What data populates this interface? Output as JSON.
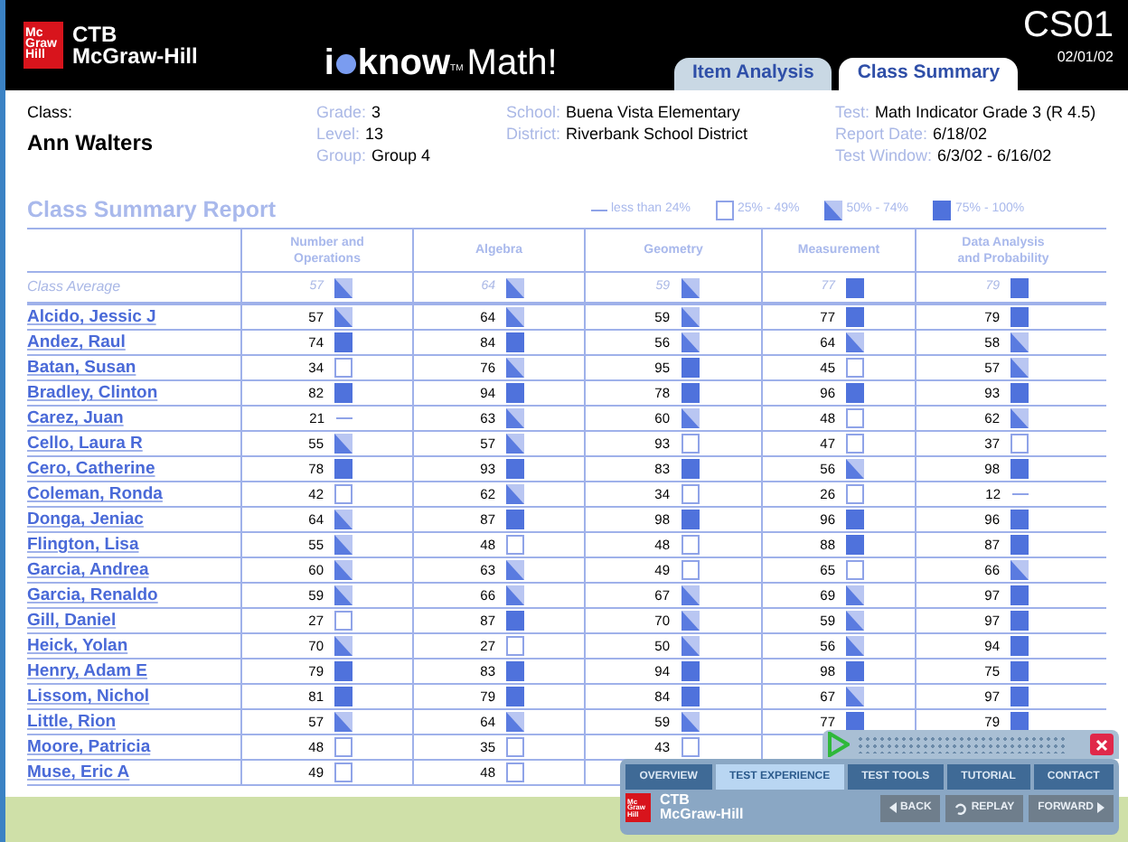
{
  "header": {
    "logo": {
      "mark": [
        "Mc",
        "Graw",
        "Hill"
      ],
      "name": [
        "CTB",
        "McGraw-Hill"
      ]
    },
    "product": {
      "pre": "i",
      "word": "know",
      "tm": "TM",
      "suffix": "Math!"
    },
    "code": "CS01",
    "date": "02/01/02"
  },
  "tabs": [
    {
      "label": "Item Analysis",
      "selected": false
    },
    {
      "label": "Class Summary",
      "selected": true
    }
  ],
  "info": {
    "class_label": "Class:",
    "class_name": "Ann Walters",
    "col1": [
      {
        "label": "Grade:",
        "value": "3"
      },
      {
        "label": "Level:",
        "value": "13"
      },
      {
        "label": "Group:",
        "value": "Group 4"
      }
    ],
    "col2": [
      {
        "label": "School:",
        "value": "Buena Vista Elementary"
      },
      {
        "label": "District:",
        "value": "Riverbank School District"
      }
    ],
    "col3": [
      {
        "label": "Test:",
        "value": "Math Indicator Grade 3 (R 4.5)"
      },
      {
        "label": "Report Date:",
        "value": "6/18/02"
      },
      {
        "label": "Test Window:",
        "value": "6/3/02 - 6/16/02"
      }
    ]
  },
  "report_title": "Class Summary Report",
  "legend": [
    {
      "kind": "low",
      "label": "less than 24%"
    },
    {
      "kind": "basic",
      "label": "25% - 49%"
    },
    {
      "kind": "mid",
      "label": "50% - 74%"
    },
    {
      "kind": "high",
      "label": "75% - 100%"
    }
  ],
  "table": {
    "columns": [
      [
        "Number and",
        "Operations"
      ],
      [
        "Algebra"
      ],
      [
        "Geometry"
      ],
      [
        "Measurement"
      ],
      [
        "Data Analysis",
        "and Probability"
      ]
    ],
    "average": {
      "label": "Class Average",
      "scores": [
        {
          "value": "57",
          "kind": "mid"
        },
        {
          "value": "64",
          "kind": "mid"
        },
        {
          "value": "59",
          "kind": "mid"
        },
        {
          "value": "77",
          "kind": "high"
        },
        {
          "value": "79",
          "kind": "high"
        }
      ]
    },
    "rows": [
      {
        "name": "Alcido, Jessic J",
        "scores": [
          {
            "value": "57",
            "kind": "mid"
          },
          {
            "value": "64",
            "kind": "mid"
          },
          {
            "value": "59",
            "kind": "mid"
          },
          {
            "value": "77",
            "kind": "high"
          },
          {
            "value": "79",
            "kind": "high"
          }
        ]
      },
      {
        "name": "Andez, Raul",
        "scores": [
          {
            "value": "74",
            "kind": "high"
          },
          {
            "value": "84",
            "kind": "high"
          },
          {
            "value": "56",
            "kind": "mid"
          },
          {
            "value": "64",
            "kind": "mid"
          },
          {
            "value": "58",
            "kind": "mid"
          }
        ]
      },
      {
        "name": "Batan, Susan",
        "scores": [
          {
            "value": "34",
            "kind": "basic"
          },
          {
            "value": "76",
            "kind": "mid"
          },
          {
            "value": "95",
            "kind": "high"
          },
          {
            "value": "45",
            "kind": "basic"
          },
          {
            "value": "57",
            "kind": "mid"
          }
        ]
      },
      {
        "name": "Bradley, Clinton",
        "scores": [
          {
            "value": "82",
            "kind": "high"
          },
          {
            "value": "94",
            "kind": "high"
          },
          {
            "value": "78",
            "kind": "high"
          },
          {
            "value": "96",
            "kind": "high"
          },
          {
            "value": "93",
            "kind": "high"
          }
        ]
      },
      {
        "name": "Carez, Juan",
        "scores": [
          {
            "value": "21",
            "kind": "low"
          },
          {
            "value": "63",
            "kind": "mid"
          },
          {
            "value": "60",
            "kind": "mid"
          },
          {
            "value": "48",
            "kind": "basic"
          },
          {
            "value": "62",
            "kind": "mid"
          }
        ]
      },
      {
        "name": "Cello, Laura R",
        "scores": [
          {
            "value": "55",
            "kind": "mid"
          },
          {
            "value": "57",
            "kind": "mid"
          },
          {
            "value": "93",
            "kind": "basic"
          },
          {
            "value": "47",
            "kind": "basic"
          },
          {
            "value": "37",
            "kind": "basic"
          }
        ]
      },
      {
        "name": "Cero, Catherine",
        "scores": [
          {
            "value": "78",
            "kind": "high"
          },
          {
            "value": "93",
            "kind": "high"
          },
          {
            "value": "83",
            "kind": "high"
          },
          {
            "value": "56",
            "kind": "mid"
          },
          {
            "value": "98",
            "kind": "high"
          }
        ]
      },
      {
        "name": "Coleman, Ronda",
        "scores": [
          {
            "value": "42",
            "kind": "basic"
          },
          {
            "value": "62",
            "kind": "mid"
          },
          {
            "value": "34",
            "kind": "basic"
          },
          {
            "value": "26",
            "kind": "basic"
          },
          {
            "value": "12",
            "kind": "low"
          }
        ]
      },
      {
        "name": "Donga, Jeniac",
        "scores": [
          {
            "value": "64",
            "kind": "mid"
          },
          {
            "value": "87",
            "kind": "high"
          },
          {
            "value": "98",
            "kind": "high"
          },
          {
            "value": "96",
            "kind": "high"
          },
          {
            "value": "96",
            "kind": "high"
          }
        ]
      },
      {
        "name": "Flington, Lisa",
        "scores": [
          {
            "value": "55",
            "kind": "mid"
          },
          {
            "value": "48",
            "kind": "basic"
          },
          {
            "value": "48",
            "kind": "basic"
          },
          {
            "value": "88",
            "kind": "high"
          },
          {
            "value": "87",
            "kind": "high"
          }
        ]
      },
      {
        "name": "Garcia, Andrea",
        "scores": [
          {
            "value": "60",
            "kind": "mid"
          },
          {
            "value": "63",
            "kind": "mid"
          },
          {
            "value": "49",
            "kind": "basic"
          },
          {
            "value": "65",
            "kind": "basic"
          },
          {
            "value": "66",
            "kind": "mid"
          }
        ]
      },
      {
        "name": "Garcia, Renaldo",
        "scores": [
          {
            "value": "59",
            "kind": "mid"
          },
          {
            "value": "66",
            "kind": "mid"
          },
          {
            "value": "67",
            "kind": "mid"
          },
          {
            "value": "69",
            "kind": "mid"
          },
          {
            "value": "97",
            "kind": "high"
          }
        ]
      },
      {
        "name": "Gill, Daniel",
        "scores": [
          {
            "value": "27",
            "kind": "basic"
          },
          {
            "value": "87",
            "kind": "high"
          },
          {
            "value": "70",
            "kind": "mid"
          },
          {
            "value": "59",
            "kind": "mid"
          },
          {
            "value": "97",
            "kind": "high"
          }
        ]
      },
      {
        "name": "Heick, Yolan",
        "scores": [
          {
            "value": "70",
            "kind": "mid"
          },
          {
            "value": "27",
            "kind": "basic"
          },
          {
            "value": "50",
            "kind": "mid"
          },
          {
            "value": "56",
            "kind": "mid"
          },
          {
            "value": "94",
            "kind": "high"
          }
        ]
      },
      {
        "name": "Henry, Adam E",
        "scores": [
          {
            "value": "79",
            "kind": "high"
          },
          {
            "value": "83",
            "kind": "high"
          },
          {
            "value": "94",
            "kind": "high"
          },
          {
            "value": "98",
            "kind": "high"
          },
          {
            "value": "75",
            "kind": "high"
          }
        ]
      },
      {
        "name": "Lissom, Nichol",
        "scores": [
          {
            "value": "81",
            "kind": "high"
          },
          {
            "value": "79",
            "kind": "high"
          },
          {
            "value": "84",
            "kind": "high"
          },
          {
            "value": "67",
            "kind": "mid"
          },
          {
            "value": "97",
            "kind": "high"
          }
        ]
      },
      {
        "name": "Little, Rion",
        "scores": [
          {
            "value": "57",
            "kind": "mid"
          },
          {
            "value": "64",
            "kind": "mid"
          },
          {
            "value": "59",
            "kind": "mid"
          },
          {
            "value": "77",
            "kind": "high"
          },
          {
            "value": "79",
            "kind": "high"
          }
        ]
      },
      {
        "name": "Moore, Patricia",
        "scores": [
          {
            "value": "48",
            "kind": "basic"
          },
          {
            "value": "35",
            "kind": "basic"
          },
          {
            "value": "43",
            "kind": "basic"
          }
        ]
      },
      {
        "name": "Muse, Eric A",
        "scores": [
          {
            "value": "49",
            "kind": "basic"
          },
          {
            "value": "48",
            "kind": "basic"
          }
        ]
      }
    ]
  },
  "player": {
    "tabs": [
      {
        "label": "OVERVIEW",
        "selected": false
      },
      {
        "label": "TEST EXPERIENCE",
        "selected": true
      },
      {
        "label": "TEST TOOLS",
        "selected": false
      },
      {
        "label": "TUTORIAL",
        "selected": false
      },
      {
        "label": "CONTACT",
        "selected": false
      }
    ],
    "logo": {
      "mark": [
        "Mc",
        "Graw",
        "Hill"
      ],
      "name": [
        "CTB",
        "McGraw-Hill"
      ]
    },
    "buttons": [
      {
        "kind": "back",
        "label": "BACK"
      },
      {
        "kind": "replay",
        "label": "REPLAY"
      },
      {
        "kind": "forward",
        "label": "FORWARD"
      }
    ]
  }
}
